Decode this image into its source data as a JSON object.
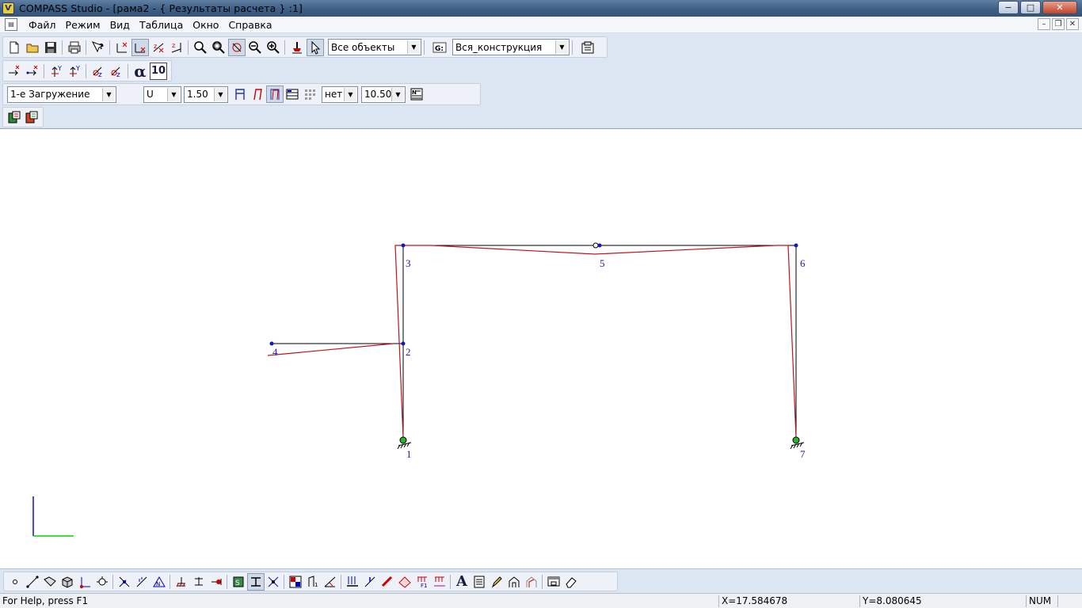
{
  "window": {
    "title": "COMPASS  Studio - [рама2 - { Результаты расчета } :1]",
    "app_icon_text": "Ѵ",
    "buttons": {
      "minimize": "−",
      "maximize": "□",
      "close": "✕"
    }
  },
  "menu": {
    "items": [
      {
        "label": "Файл"
      },
      {
        "label": "Режим"
      },
      {
        "label": "Вид"
      },
      {
        "label": "Таблица"
      },
      {
        "label": "Окно"
      },
      {
        "label": "Справка"
      }
    ],
    "mdi_buttons": {
      "minimize": "–",
      "restore": "❐",
      "close": "✕"
    }
  },
  "toolbar1": {
    "objects_select": {
      "value": "Все объекты"
    },
    "construction_select": {
      "value": "Вся_конструкция"
    },
    "group_icon_label": "G:"
  },
  "toolbar2": {
    "alpha_symbol": "α",
    "angle_value": "10"
  },
  "toolbar3": {
    "loadcase_select": {
      "value": "1-е Загружение"
    },
    "component_select": {
      "value": "U"
    },
    "scale_select": {
      "value": "1.50"
    },
    "option_select": {
      "value": "нет"
    },
    "font_size_select": {
      "value": "10.50"
    }
  },
  "model": {
    "nodes": [
      {
        "id": "1",
        "label": "1"
      },
      {
        "id": "2",
        "label": "2"
      },
      {
        "id": "3",
        "label": "3"
      },
      {
        "id": "4",
        "label": "4"
      },
      {
        "id": "5",
        "label": "5"
      },
      {
        "id": "6",
        "label": "6"
      },
      {
        "id": "7",
        "label": "7"
      }
    ],
    "colors": {
      "frame": "#000000",
      "node": "#1414c8",
      "label": "#1c1ca8",
      "deformed": "#c0141e",
      "axis_x": "#00d000",
      "axis_y": "#1010c0",
      "support_pin": "#28b428"
    }
  },
  "status": {
    "help": "For Help, press F1",
    "x": "X=17.584678",
    "y": "Y=8.080645",
    "num": "NUM"
  }
}
